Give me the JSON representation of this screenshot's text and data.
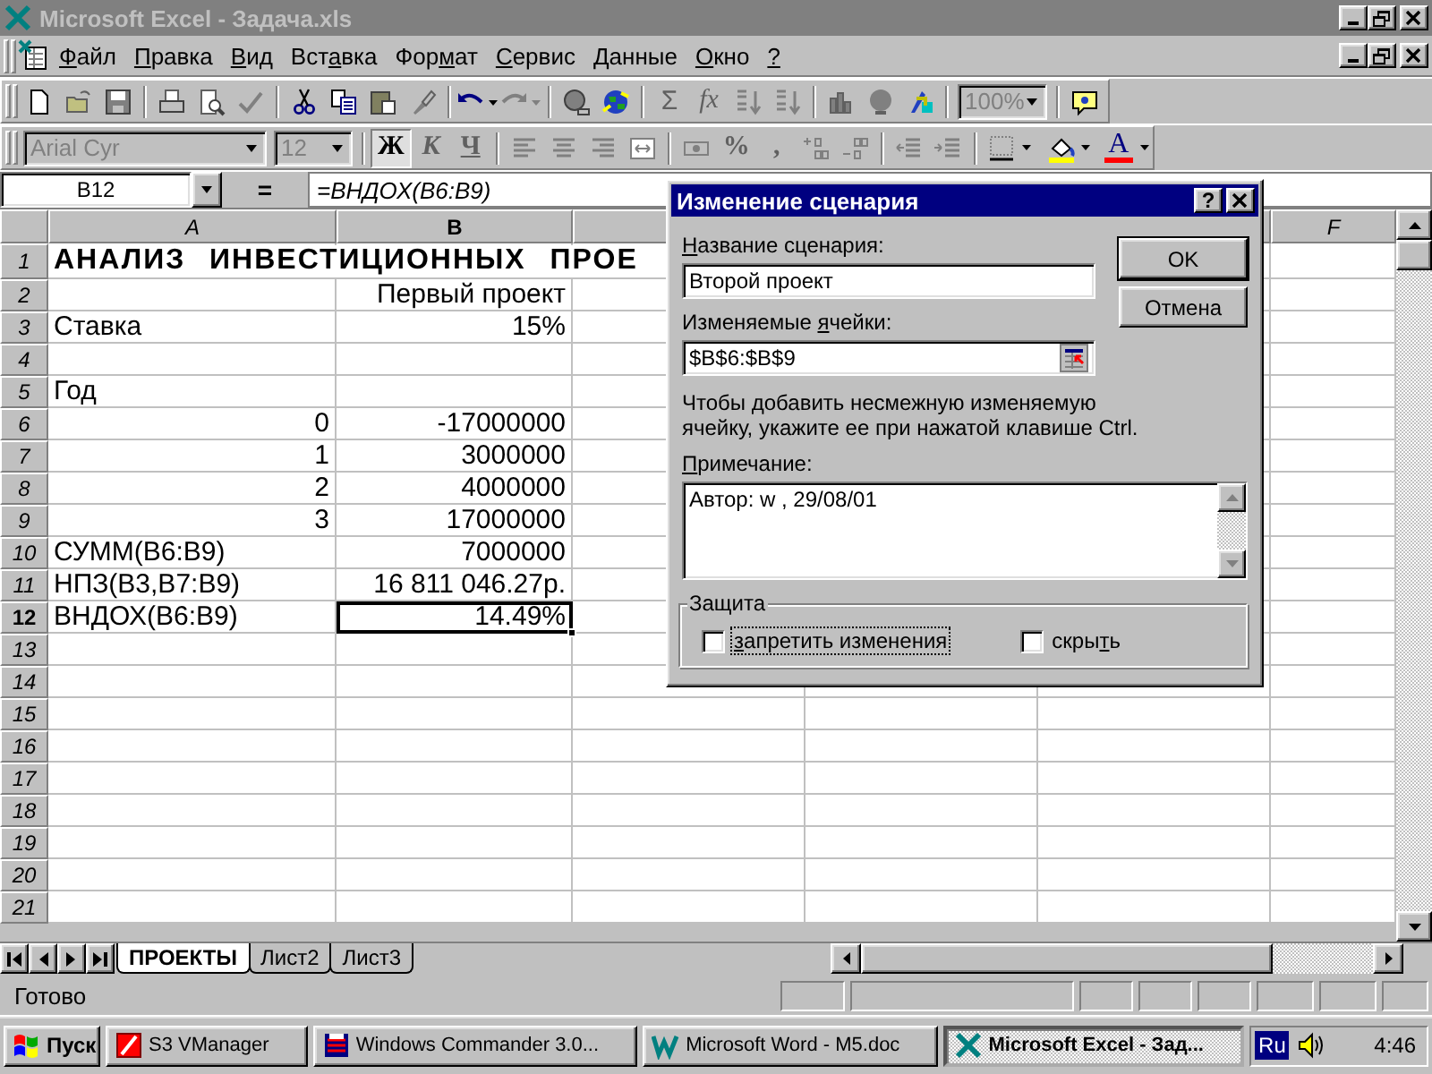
{
  "window": {
    "title": "Microsoft Excel - Задача.xls",
    "active": false
  },
  "menu": [
    {
      "key": "Ф",
      "post": "айл"
    },
    {
      "key": "П",
      "post": "равка"
    },
    {
      "key": "В",
      "post": "ид"
    },
    {
      "pre": "Вст",
      "key": "а",
      "post": "вка"
    },
    {
      "pre": "Фор",
      "key": "м",
      "post": "ат"
    },
    {
      "key": "С",
      "post": "ервис"
    },
    {
      "key": "Д",
      "post": "анные"
    },
    {
      "key": "О",
      "post": "кно"
    },
    {
      "key": "?"
    }
  ],
  "standard_toolbar": {
    "sum": "Σ",
    "function": "fx",
    "zoom": "100%"
  },
  "formatting_toolbar": {
    "font": "Arial Cyr",
    "size": "12",
    "bold": {
      "label": "Ж",
      "pressed": true
    },
    "italic": {
      "label": "К",
      "pressed": false
    },
    "underline": {
      "label": "Ч",
      "pressed": false
    },
    "percent": "%",
    "comma": ",",
    "font_color": "A"
  },
  "formula_bar": {
    "name_box": "B12",
    "equals": "=",
    "formula": "=ВНДОХ(B6:B9)"
  },
  "sheet": {
    "columns": [
      {
        "label": "A",
        "selected": false
      },
      {
        "label": "B",
        "selected": true
      },
      {
        "selected": false
      },
      {
        "selected": false
      },
      {
        "selected": false
      },
      {
        "label": "F",
        "selected": false
      }
    ],
    "rows": [
      {
        "label": "1",
        "selected": false,
        "a": {
          "text": "АНАЛИЗ ИНВЕСТИЦИОННЫХ ПРОЕ",
          "kind": "title"
        }
      },
      {
        "label": "2",
        "selected": false,
        "b": {
          "text": "Первый проект",
          "kind": "value"
        }
      },
      {
        "label": "3",
        "selected": false,
        "a": {
          "text": "Ставка",
          "kind": "label"
        },
        "b": {
          "text": "15%",
          "kind": "value"
        }
      },
      {
        "label": "4",
        "selected": false
      },
      {
        "label": "5",
        "selected": false,
        "a": {
          "text": "Год",
          "kind": "label"
        }
      },
      {
        "label": "6",
        "selected": false,
        "a": {
          "text": "0",
          "kind": "value"
        },
        "b": {
          "text": "-17000000",
          "kind": "value"
        }
      },
      {
        "label": "7",
        "selected": false,
        "a": {
          "text": "1",
          "kind": "value"
        },
        "b": {
          "text": "3000000",
          "kind": "value"
        }
      },
      {
        "label": "8",
        "selected": false,
        "a": {
          "text": "2",
          "kind": "value"
        },
        "b": {
          "text": "4000000",
          "kind": "value"
        }
      },
      {
        "label": "9",
        "selected": false,
        "a": {
          "text": "3",
          "kind": "value"
        },
        "b": {
          "text": "17000000",
          "kind": "value"
        }
      },
      {
        "label": "10",
        "selected": false,
        "a": {
          "text": "СУММ(B6:B9)",
          "kind": "label"
        },
        "b": {
          "text": "7000000",
          "kind": "value"
        }
      },
      {
        "label": "11",
        "selected": false,
        "a": {
          "text": "НПЗ(B3,B7:B9)",
          "kind": "label"
        },
        "b": {
          "text": "16 811 046.27р.",
          "kind": "value"
        }
      },
      {
        "label": "12",
        "selected": true,
        "a": {
          "text": "ВНДОХ(B6:B9)",
          "kind": "label"
        },
        "b": {
          "text": "14.49%",
          "kind": "value"
        }
      },
      {
        "label": "13",
        "selected": false
      },
      {
        "label": "14",
        "selected": false
      },
      {
        "label": "15",
        "selected": false
      },
      {
        "label": "16",
        "selected": false
      },
      {
        "label": "17",
        "selected": false
      },
      {
        "label": "18",
        "selected": false
      },
      {
        "label": "19",
        "selected": false
      },
      {
        "label": "20",
        "selected": false
      },
      {
        "label": "21",
        "selected": false
      }
    ]
  },
  "sheet_tabs": [
    {
      "label": "ПРОЕКТЫ",
      "selected": true
    },
    {
      "label": "Лист2",
      "selected": false
    },
    {
      "label": "Лист3",
      "selected": false
    }
  ],
  "status_bar": {
    "text": "Готово"
  },
  "taskbar": {
    "start": "Пуск",
    "tasks": [
      {
        "label": "S3 VManager",
        "selected": false
      },
      {
        "label": "Windows Commander 3.0...",
        "selected": false
      },
      {
        "label": "Microsoft Word - M5.doc",
        "selected": false
      },
      {
        "label": "Microsoft Excel - Зад...",
        "selected": true
      }
    ],
    "language": "Ru",
    "time": "4:46"
  },
  "dialog": {
    "title": "Изменение сценария",
    "help": "?",
    "name_label": {
      "key": "Н",
      "post": "азвание сценария:"
    },
    "name_value": "Второй проект",
    "cells_label": {
      "pre": "Изменяемые ",
      "key": "я",
      "post": "чейки:"
    },
    "cells_value": "$B$6:$B$9",
    "hint": "Чтобы добавить несмежную изменяемую\nячейку, укажите ее при нажатой клавише Ctrl.",
    "comment_label": {
      "key": "П",
      "post": "римечание:"
    },
    "comment_value": "Автор: w , 29/08/01",
    "protection": {
      "title": "Защита",
      "options": [
        {
          "label": {
            "key": "з",
            "post": "апретить изменения"
          },
          "checked": false,
          "focused": true
        },
        {
          "label": {
            "pre": "скры",
            "key": "т",
            "post": "ь"
          },
          "checked": false,
          "focused": false
        }
      ]
    },
    "buttons": [
      {
        "label": "OK",
        "default": true
      },
      {
        "label": "Отмена",
        "default": false
      }
    ]
  }
}
